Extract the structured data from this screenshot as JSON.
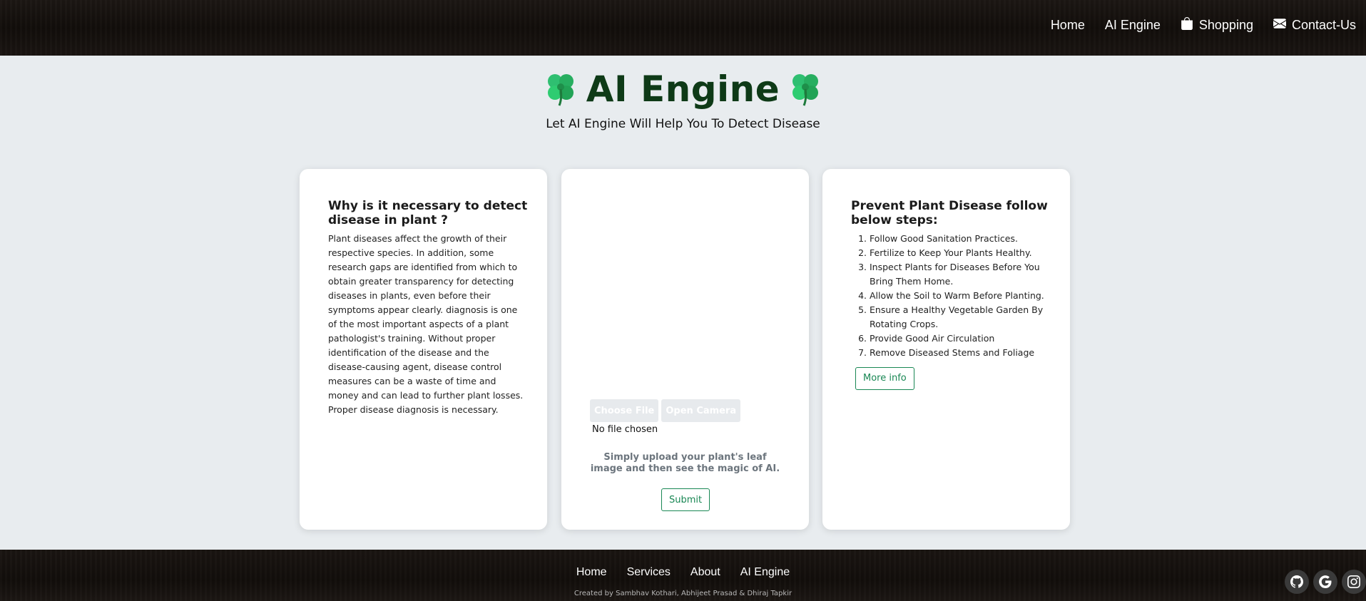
{
  "nav": {
    "items": [
      {
        "label": "Home",
        "icon": null
      },
      {
        "label": "AI Engine",
        "icon": null
      },
      {
        "label": "Shopping",
        "icon": "shopping-bag-icon"
      },
      {
        "label": "Contact-Us",
        "icon": "envelope-icon"
      }
    ]
  },
  "header": {
    "title": "AI Engine",
    "subtitle": "Let AI Engine Will Help You To Detect Disease"
  },
  "left_card": {
    "title": "Why is it necessary to detect disease in plant ?",
    "body": "Plant diseases affect the growth of their respective species. In addition, some research gaps are identified from which to obtain greater transparency for detecting diseases in plants, even before their symptoms appear clearly. diagnosis is one of the most important aspects of a plant pathologist's training. Without proper identification of the disease and the disease-causing agent, disease control measures can be a waste of time and money and can lead to further plant losses. Proper disease diagnosis is necessary."
  },
  "upload_card": {
    "choose_file": "Choose File",
    "open_camera": "Open Camera",
    "file_status": "No file chosen",
    "helper": "Simply upload your plant's leaf image and then see the magic of AI.",
    "submit": "Submit"
  },
  "right_card": {
    "title": "Prevent Plant Disease follow below steps:",
    "steps": [
      "Follow Good Sanitation Practices.",
      "Fertilize to Keep Your Plants Healthy.",
      "Inspect Plants for Diseases Before You Bring Them Home.",
      "Allow the Soil to Warm Before Planting.",
      "Ensure a Healthy Vegetable Garden By Rotating Crops.",
      "Provide Good Air Circulation",
      "Remove Diseased Stems and Foliage"
    ],
    "more_info": "More info"
  },
  "footer": {
    "links": [
      "Home",
      "Services",
      "About",
      "AI Engine"
    ],
    "credits": "Created by Sambhav Kothari, Abhijeet Prasad & Dhiraj Tapkir",
    "social": [
      "github-icon",
      "google-icon",
      "instagram-icon"
    ]
  },
  "colors": {
    "accent_green": "#198754",
    "title_green": "#0e3a17",
    "page_bg": "#e8ecef",
    "bar_bg": "#17120f"
  }
}
